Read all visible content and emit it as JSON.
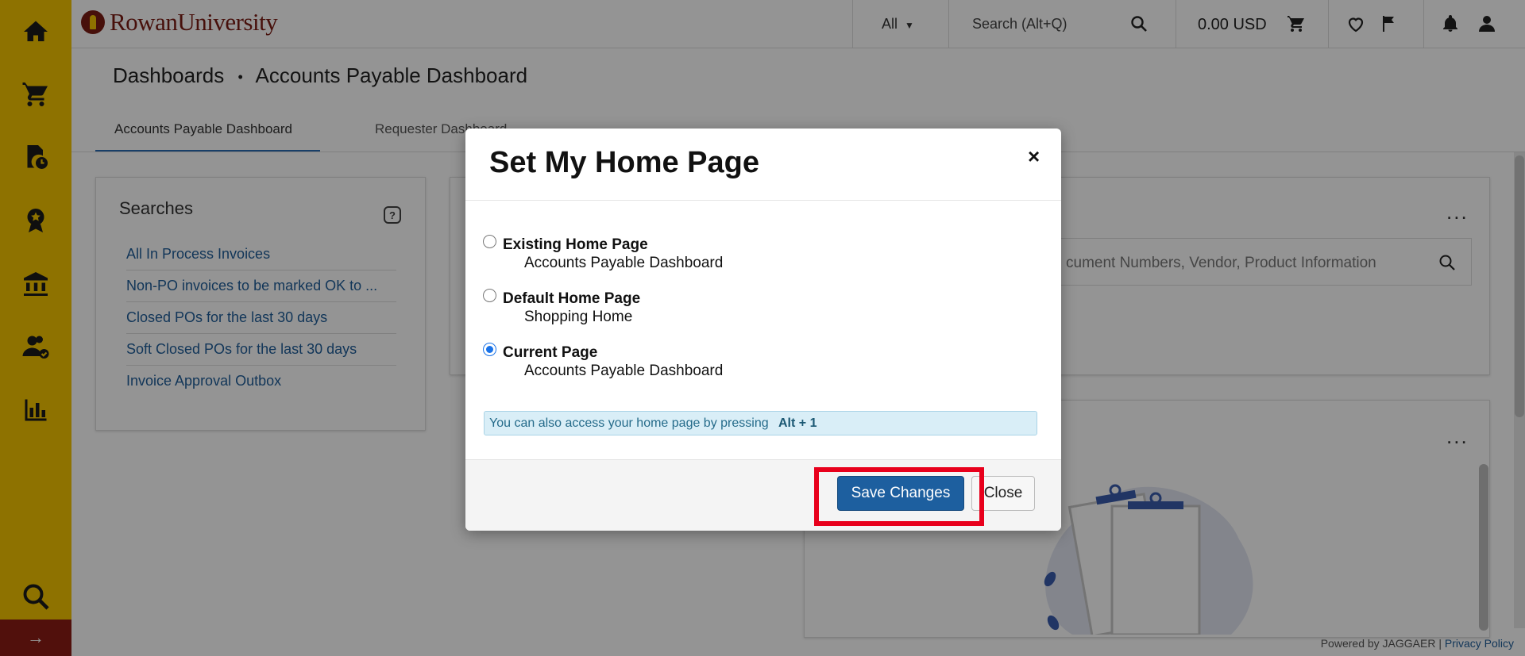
{
  "header": {
    "brand_name": "RowanUniversity",
    "scope_select": "All",
    "search_placeholder": "Search (Alt+Q)",
    "cart_total": "0.00 USD"
  },
  "sidebar": {
    "items": [
      "home-icon",
      "shopping-cart-icon",
      "document-clock-icon",
      "award-icon",
      "bank-icon",
      "users-check-icon",
      "bar-chart-icon"
    ],
    "search": "search-icon",
    "expand": "→"
  },
  "page": {
    "breadcrumb_root": "Dashboards",
    "breadcrumb_sep": "•",
    "breadcrumb_current": "Accounts Payable Dashboard",
    "tabs": [
      {
        "label": "Accounts Payable Dashboard",
        "active": true
      },
      {
        "label": "Requester Dashboard",
        "active": false
      }
    ]
  },
  "searches_card": {
    "title": "Searches",
    "links": [
      "All In Process Invoices",
      "Non-PO invoices to be marked OK to ...",
      "Closed POs for the last 30 days",
      "Soft Closed POs for the last 30 days",
      "Invoice Approval Outbox"
    ]
  },
  "doc_search": {
    "placeholder": "cument Numbers, Vendor, Product Information",
    "more": "..."
  },
  "widget2": {
    "more": "..."
  },
  "footer": {
    "powered": "Powered by JAGGAER |",
    "privacy": "Privacy Policy"
  },
  "modal": {
    "title": "Set My Home Page",
    "close_icon": "×",
    "options": [
      {
        "label": "Existing Home Page",
        "value": "Accounts Payable Dashboard",
        "checked": false
      },
      {
        "label": "Default Home Page",
        "value": "Shopping Home",
        "checked": false
      },
      {
        "label": "Current Page",
        "value": "Accounts Payable Dashboard",
        "checked": true
      }
    ],
    "info_text": "You can also access your home page by pressing",
    "info_key": "Alt + 1",
    "save_label": "Save Changes",
    "close_label": "Close"
  },
  "colors": {
    "sidebar": "#f5c400",
    "brand": "#7a1c14",
    "primary_button": "#1d5f9f",
    "highlight": "#e8001c"
  }
}
